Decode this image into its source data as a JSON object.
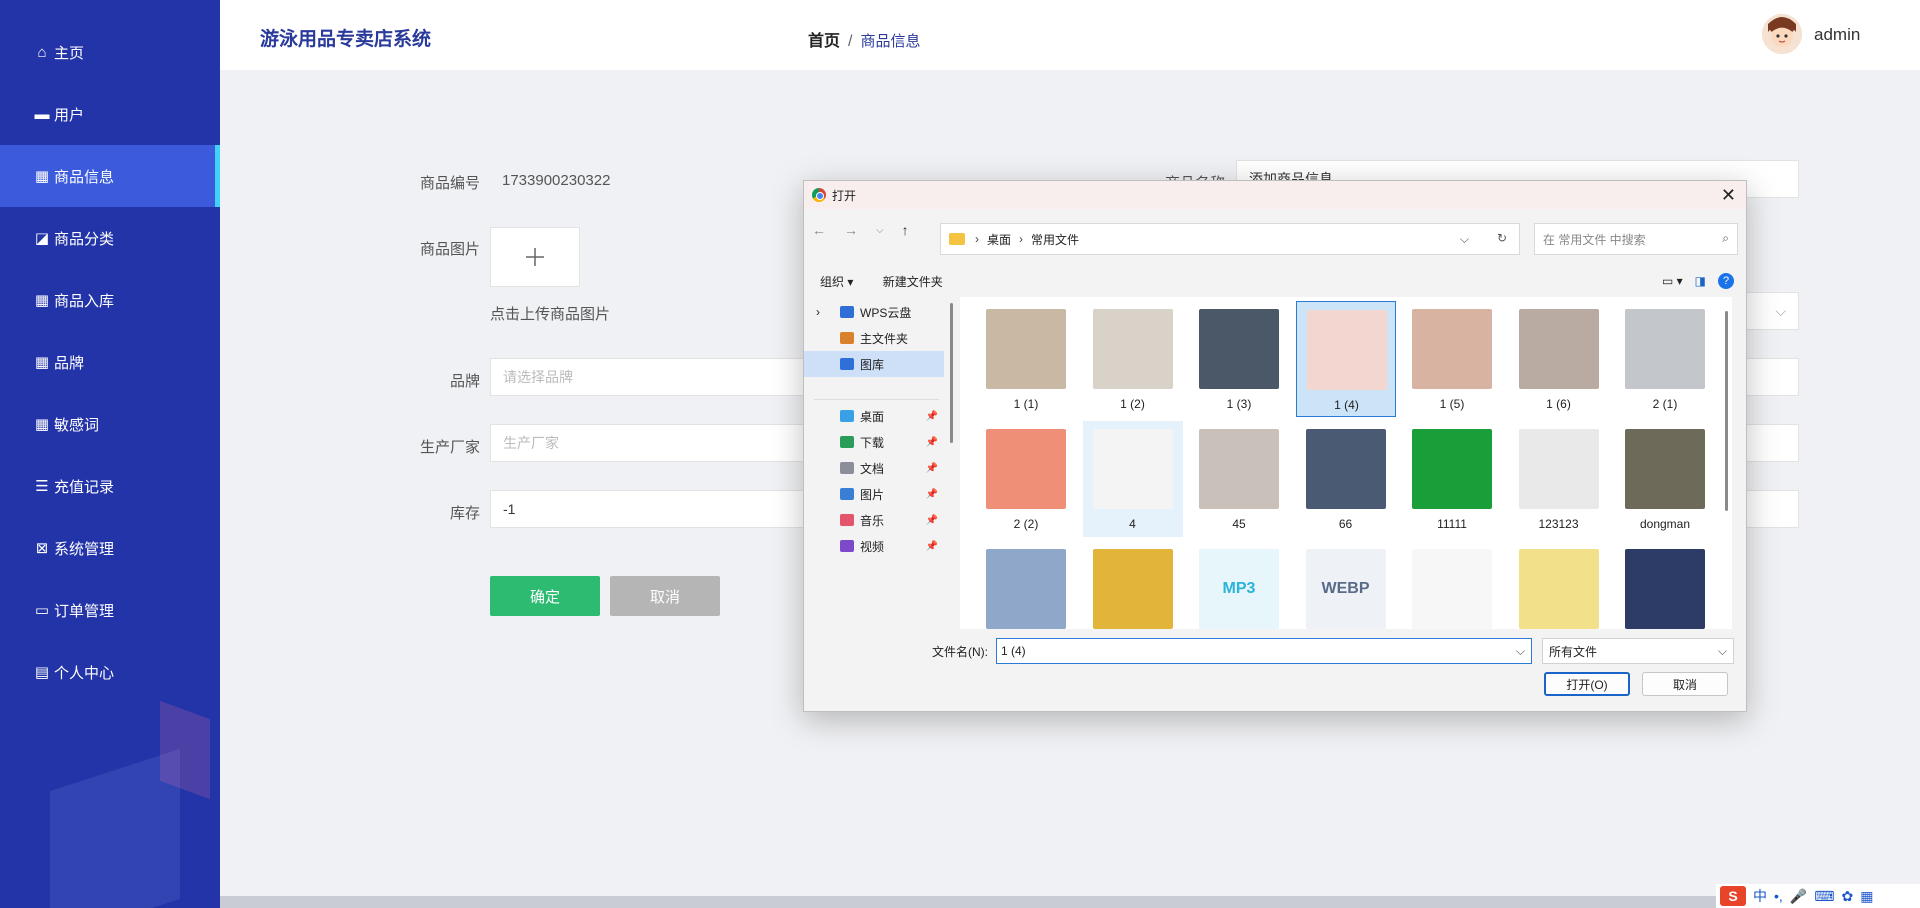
{
  "sidebar": {
    "items": [
      {
        "label": "主页",
        "icon": "home-icon"
      },
      {
        "label": "用户",
        "icon": "chat-icon"
      },
      {
        "label": "商品信息",
        "icon": "grid-icon"
      },
      {
        "label": "商品分类",
        "icon": "chart-icon"
      },
      {
        "label": "商品入库",
        "icon": "grid-icon"
      },
      {
        "label": "品牌",
        "icon": "grid-icon"
      },
      {
        "label": "敏感词",
        "icon": "grid-icon"
      },
      {
        "label": "充值记录",
        "icon": "sliders-icon"
      },
      {
        "label": "系统管理",
        "icon": "x-box-icon"
      },
      {
        "label": "订单管理",
        "icon": "printer-icon"
      },
      {
        "label": "个人中心",
        "icon": "card-icon"
      }
    ],
    "active_index": 2
  },
  "header": {
    "app_title": "游泳用品专卖店系统",
    "breadcrumb_home": "首页",
    "breadcrumb_sep": "/",
    "breadcrumb_current": "商品信息",
    "user_name": "admin"
  },
  "form": {
    "code_label": "商品编号",
    "code_value": "1733900230322",
    "name_label": "商品名称",
    "name_value": "添加商品信息",
    "image_label": "商品图片",
    "upload_hint": "点击上传商品图片",
    "brand_label": "品牌",
    "brand_placeholder": "请选择品牌",
    "maker_label": "生产厂家",
    "maker_placeholder": "生产厂家",
    "stock_label": "库存",
    "stock_value": "-1",
    "ok_label": "确定",
    "cancel_label": "取消"
  },
  "dialog": {
    "title": "打开",
    "path": [
      "桌面",
      "常用文件"
    ],
    "search_placeholder": "在 常用文件 中搜索",
    "organize_label": "组织 ▾",
    "new_folder_label": "新建文件夹",
    "left_items": [
      {
        "label": "WPS云盘",
        "color": "#2f6fd8"
      },
      {
        "label": "主文件夹",
        "color": "#d9822b"
      },
      {
        "label": "图库",
        "color": "#2f6fd8"
      },
      {
        "label": "桌面",
        "color": "#3aa0e6"
      },
      {
        "label": "下载",
        "color": "#2a9d5b"
      },
      {
        "label": "文档",
        "color": "#8a8f9a"
      },
      {
        "label": "图片",
        "color": "#3a7fd6"
      },
      {
        "label": "音乐",
        "color": "#e2556a"
      },
      {
        "label": "视频",
        "color": "#7b49c9"
      }
    ],
    "files": [
      {
        "name": "1 (1)",
        "color": "#c8b8a4"
      },
      {
        "name": "1 (2)",
        "color": "#d9d2c9"
      },
      {
        "name": "1 (3)",
        "color": "#4a5868"
      },
      {
        "name": "1 (4)",
        "color": "#f2d6cf"
      },
      {
        "name": "1 (5)",
        "color": "#d8b3a2"
      },
      {
        "name": "1 (6)",
        "color": "#b9aaa2"
      },
      {
        "name": "2 (1)",
        "color": "#c3c6cb"
      },
      {
        "name": "2 (2)",
        "color": "#ef8f77"
      },
      {
        "name": "4",
        "color": "#f4f4f4"
      },
      {
        "name": "45",
        "color": "#c9c1b9"
      },
      {
        "name": "66",
        "color": "#4a5a72"
      },
      {
        "name": "11111",
        "color": "#1a9e3a"
      },
      {
        "name": "123123",
        "color": "#e9e9e9"
      },
      {
        "name": "dongman",
        "color": "#6e6a5a"
      },
      {
        "name": "",
        "color": "#8fa7c8"
      },
      {
        "name": "",
        "color": "#e2b53a"
      },
      {
        "name": "MP3",
        "color": "#e6f6fb"
      },
      {
        "name": "WEBP",
        "color": "#eef1f6"
      },
      {
        "name": "",
        "color": "#f7f7f7"
      },
      {
        "name": "",
        "color": "#f3e08a"
      },
      {
        "name": "",
        "color": "#2c3c66"
      }
    ],
    "selected_file": "1 (4)",
    "filename_label": "文件名(N):",
    "filename_value": "1 (4)",
    "filetype_value": "所有文件",
    "open_label": "打开(O)",
    "cancel_label": "取消"
  },
  "ime": {
    "logo": "S",
    "mode": "中"
  }
}
